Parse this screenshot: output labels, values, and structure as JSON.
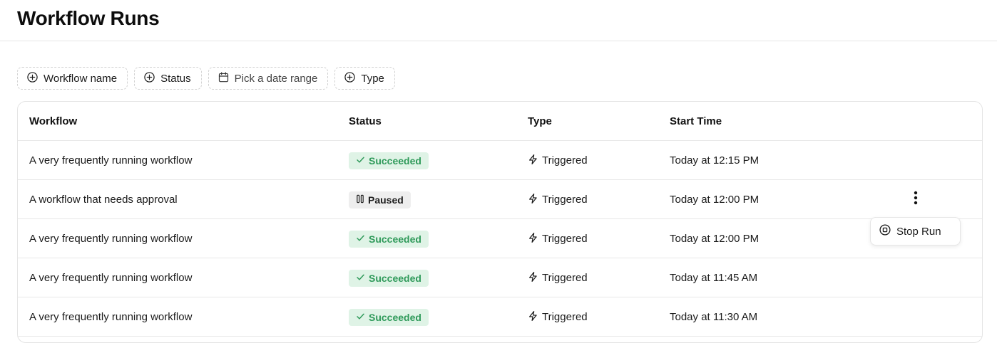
{
  "page": {
    "title": "Workflow Runs"
  },
  "filters": [
    {
      "label": "Workflow name",
      "icon": "plus-circle-icon"
    },
    {
      "label": "Status",
      "icon": "plus-circle-icon"
    },
    {
      "label": "Pick a date range",
      "icon": "calendar-icon"
    },
    {
      "label": "Type",
      "icon": "plus-circle-icon"
    }
  ],
  "table": {
    "columns": [
      "Workflow",
      "Status",
      "Type",
      "Start Time"
    ],
    "rows": [
      {
        "workflow": "A very frequently running workflow",
        "status": "Succeeded",
        "status_kind": "success",
        "type": "Triggered",
        "start_time": "Today at 12:15 PM"
      },
      {
        "workflow": "A workflow that needs approval",
        "status": "Paused",
        "status_kind": "paused",
        "type": "Triggered",
        "start_time": "Today at 12:00 PM"
      },
      {
        "workflow": "A very frequently running workflow",
        "status": "Succeeded",
        "status_kind": "success",
        "type": "Triggered",
        "start_time": "Today at 12:00 PM"
      },
      {
        "workflow": "A very frequently running workflow",
        "status": "Succeeded",
        "status_kind": "success",
        "type": "Triggered",
        "start_time": "Today at 11:45 AM"
      },
      {
        "workflow": "A very frequently running workflow",
        "status": "Succeeded",
        "status_kind": "success",
        "type": "Triggered",
        "start_time": "Today at 11:30 AM"
      }
    ]
  },
  "row_menu": {
    "item_label": "Stop Run",
    "icon": "stop-circle-icon"
  },
  "colors": {
    "success_bg": "#dff3e6",
    "success_text": "#2f9a5a",
    "paused_bg": "#eeeeee"
  }
}
